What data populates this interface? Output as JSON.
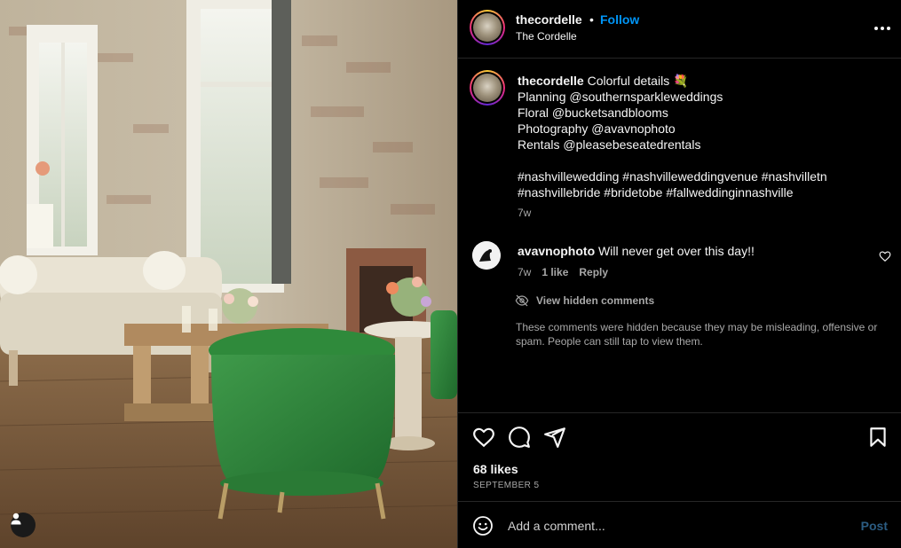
{
  "post": {
    "username": "thecordelle",
    "location": "The Cordelle",
    "follow_label": "Follow",
    "dot": "•",
    "more_icon": "more-horizontal-icon"
  },
  "caption": {
    "username": "thecordelle",
    "title": "Colorful details 💐",
    "lines": [
      "Planning @southernsparkleweddings",
      "Floral @bucketsandblooms",
      "Photography @avavnophoto",
      "Rentals @pleasebeseatedrentals"
    ],
    "hashtags_line1": "#nashvillewedding #nashvilleweddingvenue #nashvilletn",
    "hashtags_line2": "#nashvillebride #bridetobe #fallweddinginnashville",
    "time": "7w"
  },
  "comment": {
    "username": "avavnophoto",
    "text": "Will never get over this day!!",
    "time": "7w",
    "likes": "1 like",
    "reply": "Reply"
  },
  "hidden_comments": {
    "label": "View hidden comments",
    "note": "These comments were hidden because they may be misleading, offensive or spam. People can still tap to view them."
  },
  "engagement": {
    "likes": "68 likes",
    "date": "SEPTEMBER 5"
  },
  "add_comment": {
    "placeholder": "Add a comment...",
    "post_label": "Post"
  },
  "colors": {
    "accent": "#0095f6",
    "post_disabled": "#2b5c82",
    "secondary_text": "#a8a8a8",
    "divider": "#262626"
  }
}
